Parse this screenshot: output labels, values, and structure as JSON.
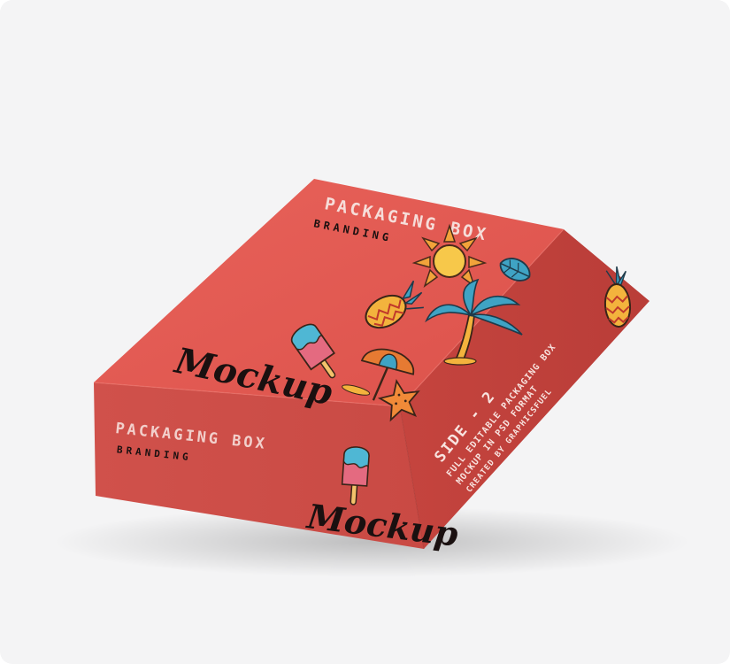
{
  "box": {
    "top": {
      "title": "PACKAGING BOX",
      "subtitle": "BRANDING",
      "script": "Mockup"
    },
    "front": {
      "title": "PACKAGING BOX",
      "subtitle": "BRANDING",
      "script": "Mockup"
    },
    "side": {
      "heading": "SIDE - 2",
      "line1": "FULL EDITABLE PACKAGING BOX",
      "line2": "MOCKUP IN PSD FORMAT",
      "line3": "CREATED BY GRAPHICSFUEL"
    }
  },
  "colors": {
    "background": "#f4f4f5",
    "box_top": "#e2574f",
    "box_front": "#d44e49",
    "box_side": "#c8453f",
    "title_text": "#f4d9d6",
    "dark_text": "#1a1010"
  },
  "icons": [
    "sun-icon",
    "leaf-icon",
    "pineapple-icon",
    "palm-tree-icon",
    "popsicle-icon",
    "umbrella-icon",
    "starfish-icon"
  ]
}
